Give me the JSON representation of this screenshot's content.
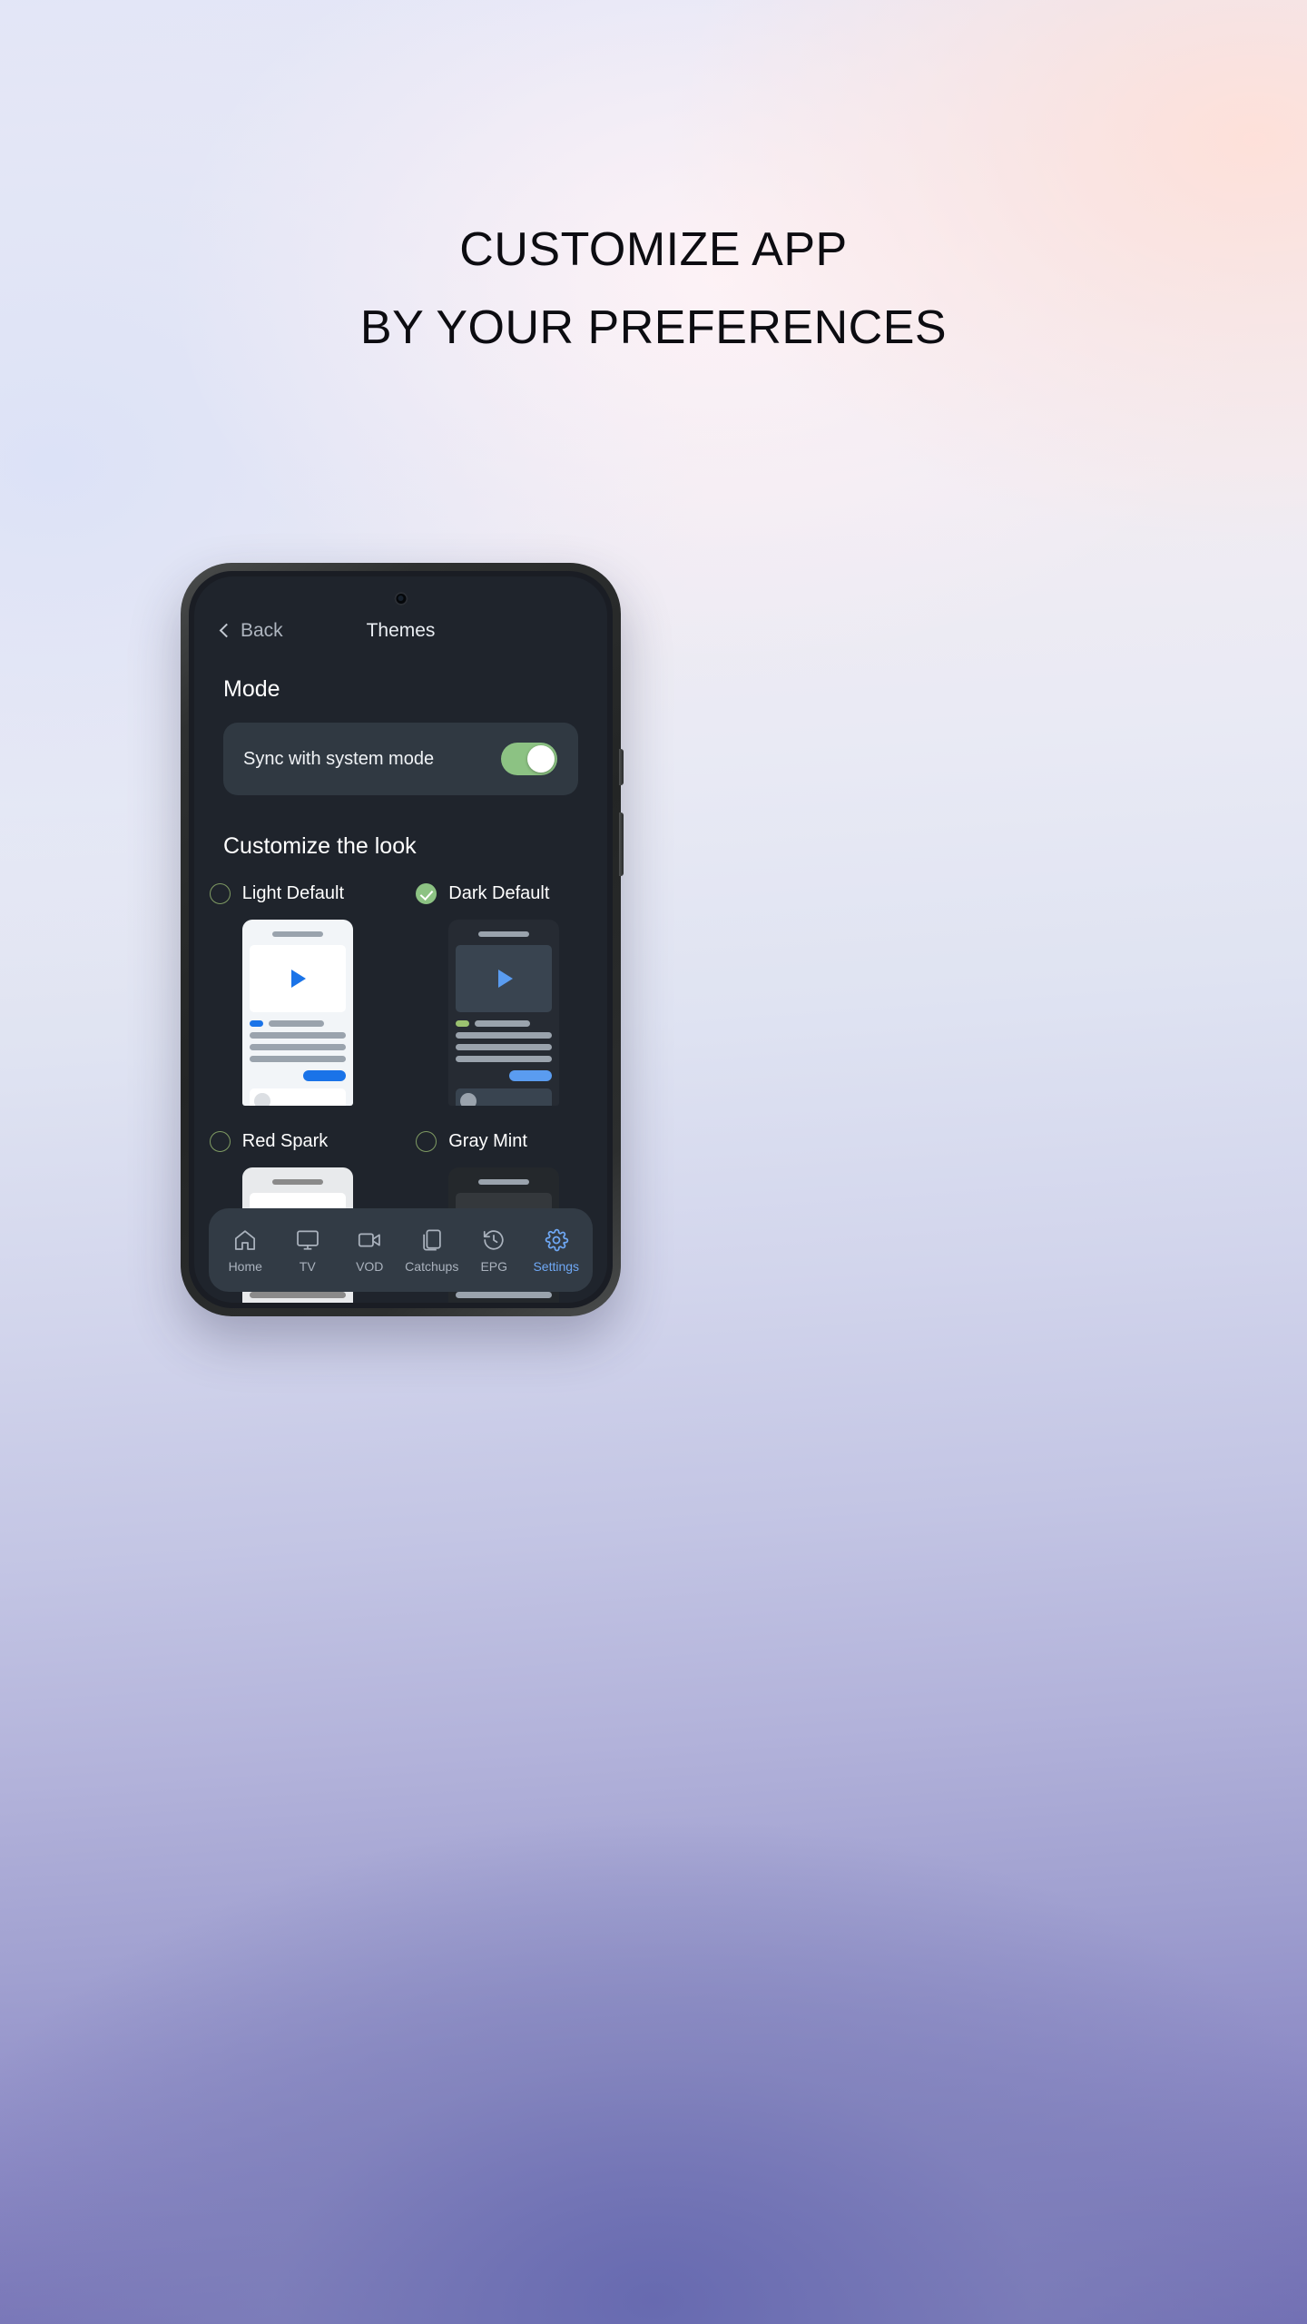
{
  "promo": {
    "line1": "CUSTOMIZE APP",
    "line2": "BY YOUR PREFERENCES"
  },
  "app": {
    "back_label": "Back",
    "screen_title": "Themes",
    "sections": {
      "mode_title": "Mode",
      "look_title": "Customize the look"
    },
    "sync_row": {
      "label": "Sync with system mode",
      "toggle_state": "on"
    },
    "themes": [
      {
        "label": "Light Default",
        "selected": false,
        "colors": {
          "frame": "#f2f5f8",
          "speaker": "#9aa3ad",
          "video": "#ffffff",
          "accent": "#1a73e8",
          "chip": "#1a73e8",
          "line": "#9aa3ad",
          "bar": "#9aa3ad",
          "row": "#ffffff",
          "avatar": "#dcdfe3"
        }
      },
      {
        "label": "Dark Default",
        "selected": true,
        "colors": {
          "frame": "#262b33",
          "speaker": "#9aa3ad",
          "video": "#394450",
          "accent": "#5a9cf0",
          "chip": "#9bc270",
          "line": "#9aa3ad",
          "bar": "#9aa3ad",
          "row": "#394450",
          "avatar": "#9aa3ad"
        }
      },
      {
        "label": "Red Spark",
        "selected": false,
        "colors": {
          "frame": "#e8eaec",
          "speaker": "#8a8a8a",
          "video": "#ffffff",
          "accent": "#c50711",
          "chip": "#b7c22e",
          "line": "#8a8a8a",
          "bar": "#8a8a8a",
          "row": "#ffffff",
          "avatar": "#7b7b7b"
        }
      },
      {
        "label": "Gray Mint",
        "selected": false,
        "colors": {
          "frame": "#24282c",
          "speaker": "#9aa3ad",
          "video": "#34383c",
          "accent": "#5bb3a4",
          "chip": "#3f9ae0",
          "line": "#9aa3ad",
          "bar": "#9aa3ad",
          "row": "#34383c",
          "avatar": "#9aa3ad"
        }
      }
    ],
    "bottom_nav": [
      {
        "label": "Home",
        "icon": "home-icon",
        "active": false
      },
      {
        "label": "TV",
        "icon": "monitor-icon",
        "active": false
      },
      {
        "label": "VOD",
        "icon": "video-camera-icon",
        "active": false
      },
      {
        "label": "Catchups",
        "icon": "layers-icon",
        "active": false
      },
      {
        "label": "EPG",
        "icon": "history-icon",
        "active": false
      },
      {
        "label": "Settings",
        "icon": "gear-icon",
        "active": true
      }
    ]
  },
  "theme_colors": {
    "toggle_on": "#8cc283",
    "radio_outline": "#7f9b63",
    "nav_active": "#6fa8f5",
    "nav_inactive": "#aab2bd",
    "screen_bg": "#1f242c",
    "card_bg": "#303942"
  }
}
